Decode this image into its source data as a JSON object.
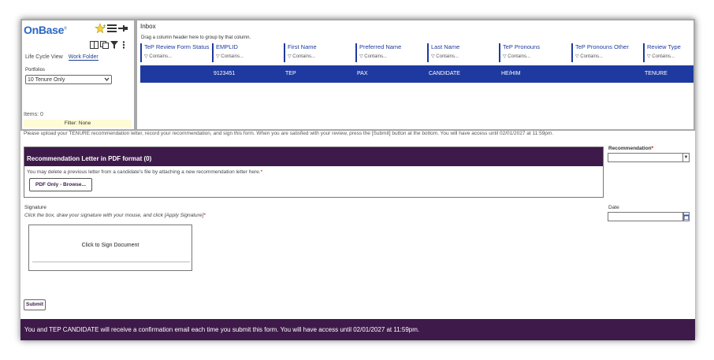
{
  "app": {
    "logo": "OnBase",
    "logo_mark": "®"
  },
  "left_panel": {
    "views": [
      "Life Cycle View",
      "Work Folder"
    ],
    "portfolios_label": "Portfolios",
    "portfolio_selected": "10 Tenure Only",
    "items_label": "Items: 0",
    "filter_label": "Filter: None"
  },
  "inbox": {
    "title": "Inbox",
    "group_hint": "Drag a column header here to group by that column.",
    "filter_placeholder": "Contains...",
    "columns": [
      "TeP Review Form Status",
      "EMPLID",
      "First Name",
      "Preferred Name",
      "Last Name",
      "TeP Pronouns",
      "TeP Pronouns Other",
      "Review Type"
    ],
    "rows": [
      [
        "",
        "9123451",
        "TEP",
        "PAX",
        "CANDIDATE",
        "HE/HIM",
        "",
        "TENURE"
      ]
    ]
  },
  "form": {
    "instructions": "Please upload your TENURE recommendation letter, record your recommendation, and sign this form. When you are satisfied with your review, press the [Submit] button at the bottom. You will have access until 02/01/2027 at 11:59pm.",
    "rec_letter_heading": "Recommendation Letter in PDF format (0)",
    "rec_letter_text": "You may delete a previous letter from a candidate's file by attaching a new recommendation letter here.",
    "required_mark": "*",
    "browse_label": "PDF Only - Browse...",
    "recommendation_label": "Recommendation",
    "signature_label": "Signature",
    "signature_hint": "Click the box, draw your signature with your mouse, and click [Apply Signature]",
    "sign_prompt": "Click to Sign Document",
    "date_label": "Date",
    "submit_label": "Submit",
    "footer_text": "You and TEP CANDIDATE will receive a confirmation email each time you submit this form. You will have access until 02/01/2027 at 11:59pm."
  },
  "colors": {
    "brand_blue": "#1e3aa0",
    "header_purple": "#3e1a4a",
    "filter_yellow": "#fffbd6"
  }
}
